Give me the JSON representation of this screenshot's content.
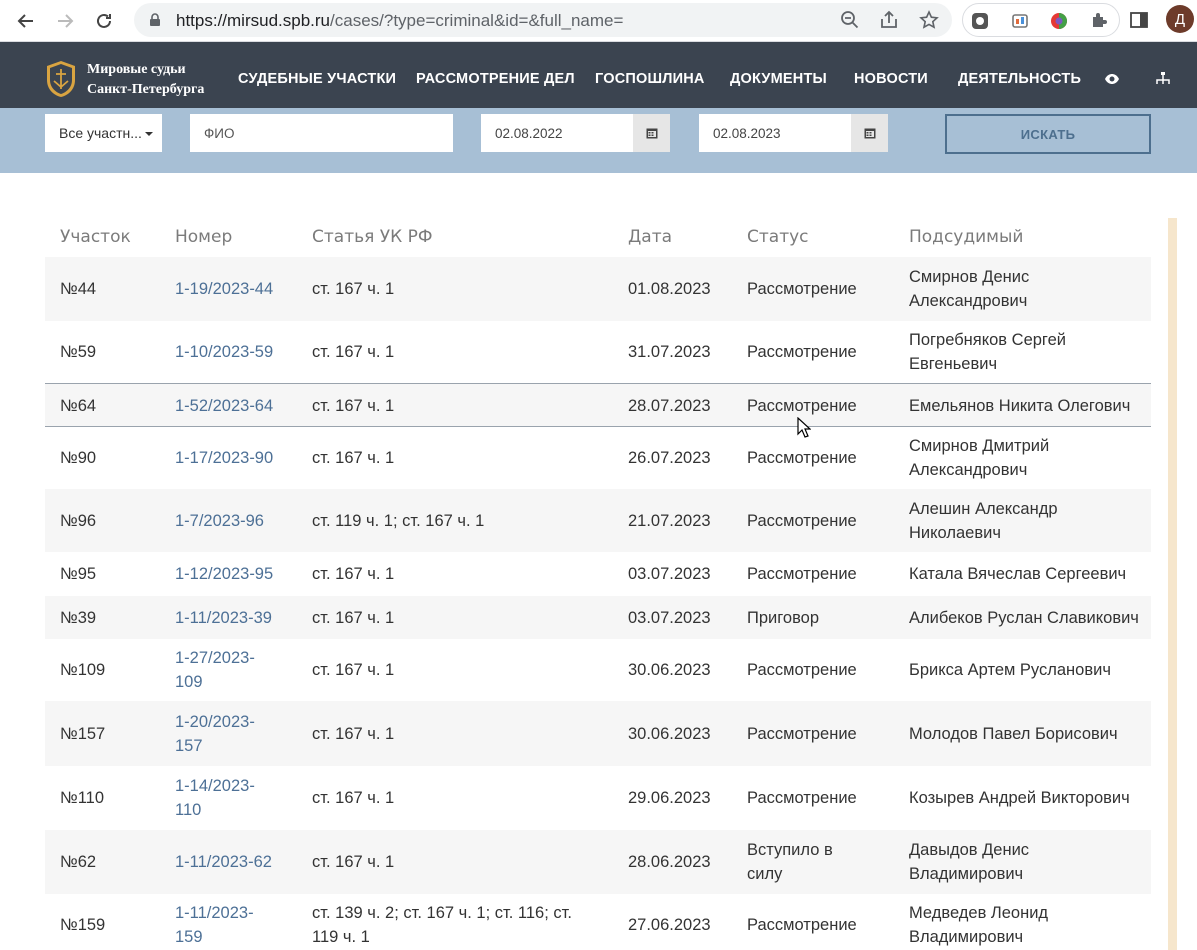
{
  "browser": {
    "url_host": "https://mirsud.spb.ru",
    "url_rest": "/cases/?type=criminal&id=&full_name=",
    "profile_letter": "Д"
  },
  "site": {
    "logo_line1": "Мировые судьи",
    "logo_line2": "Санкт-Петербурга",
    "menu": [
      "СУДЕБНЫЕ УЧАСТКИ",
      "РАССМОТРЕНИЕ ДЕЛ",
      "ГОСПОШЛИНА",
      "ДОКУМЕНТЫ",
      "НОВОСТИ",
      "ДЕЯТЕЛЬНОСТЬ"
    ]
  },
  "filters": {
    "district_select": "Все участн...",
    "fio_placeholder": "ФИО",
    "date_from": "02.08.2022",
    "date_to": "02.08.2023",
    "search_button": "ИСКАТЬ"
  },
  "table": {
    "headers": [
      "Участок",
      "Номер",
      "Статья УК РФ",
      "Дата",
      "Статус",
      "Подсудимый"
    ],
    "rows": [
      {
        "uch": "№44",
        "num1": "1-19/2023-44",
        "num2": "",
        "art1": "ст. 167 ч. 1",
        "art2": "",
        "date": "01.08.2023",
        "status1": "Рассмотрение",
        "status2": "",
        "name1": "Смирнов Денис",
        "name2": "Александрович"
      },
      {
        "uch": "№59",
        "num1": "1-10/2023-59",
        "num2": "",
        "art1": "ст. 167 ч. 1",
        "art2": "",
        "date": "31.07.2023",
        "status1": "Рассмотрение",
        "status2": "",
        "name1": "Погребняков Сергей",
        "name2": "Евгеньевич"
      },
      {
        "uch": "№64",
        "num1": "1-52/2023-64",
        "num2": "",
        "art1": "ст. 167 ч. 1",
        "art2": "",
        "date": "28.07.2023",
        "status1": "Рассмотрение",
        "status2": "",
        "name1": "Емельянов Никита Олегович",
        "name2": ""
      },
      {
        "uch": "№90",
        "num1": "1-17/2023-90",
        "num2": "",
        "art1": "ст. 167 ч. 1",
        "art2": "",
        "date": "26.07.2023",
        "status1": "Рассмотрение",
        "status2": "",
        "name1": "Смирнов Дмитрий",
        "name2": "Александрович"
      },
      {
        "uch": "№96",
        "num1": "1-7/2023-96",
        "num2": "",
        "art1": "ст. 119 ч. 1; ст. 167 ч. 1",
        "art2": "",
        "date": "21.07.2023",
        "status1": "Рассмотрение",
        "status2": "",
        "name1": "Алешин Александр",
        "name2": "Николаевич"
      },
      {
        "uch": "№95",
        "num1": "1-12/2023-95",
        "num2": "",
        "art1": "ст. 167 ч. 1",
        "art2": "",
        "date": "03.07.2023",
        "status1": "Рассмотрение",
        "status2": "",
        "name1": "Катала Вячеслав Сергеевич",
        "name2": ""
      },
      {
        "uch": "№39",
        "num1": "1-11/2023-39",
        "num2": "",
        "art1": "ст. 167 ч. 1",
        "art2": "",
        "date": "03.07.2023",
        "status1": "Приговор",
        "status2": "",
        "name1": "Алибеков Руслан Славикович",
        "name2": ""
      },
      {
        "uch": "№109",
        "num1": "1-27/2023-",
        "num2": "109",
        "art1": "ст. 167 ч. 1",
        "art2": "",
        "date": "30.06.2023",
        "status1": "Рассмотрение",
        "status2": "",
        "name1": "Брикса Артем Русланович",
        "name2": ""
      },
      {
        "uch": "№157",
        "num1": "1-20/2023-",
        "num2": "157",
        "art1": "ст. 167 ч. 1",
        "art2": "",
        "date": "30.06.2023",
        "status1": "Рассмотрение",
        "status2": "",
        "name1": "Молодов Павел Борисович",
        "name2": ""
      },
      {
        "uch": "№110",
        "num1": "1-14/2023-",
        "num2": "110",
        "art1": "ст. 167 ч. 1",
        "art2": "",
        "date": "29.06.2023",
        "status1": "Рассмотрение",
        "status2": "",
        "name1": "Козырев Андрей Викторович",
        "name2": ""
      },
      {
        "uch": "№62",
        "num1": "1-11/2023-62",
        "num2": "",
        "art1": "ст. 167 ч. 1",
        "art2": "",
        "date": "28.06.2023",
        "status1": "Вступило в",
        "status2": "силу",
        "name1": "Давыдов Денис",
        "name2": "Владимирович"
      },
      {
        "uch": "№159",
        "num1": "1-11/2023-",
        "num2": "159",
        "art1": "ст. 139 ч. 2; ст. 167 ч. 1; ст. 116; ст.",
        "art2": "119 ч. 1",
        "date": "27.06.2023",
        "status1": "Рассмотрение",
        "status2": "",
        "name1": "Медведев Леонид",
        "name2": "Владимирович"
      }
    ]
  }
}
